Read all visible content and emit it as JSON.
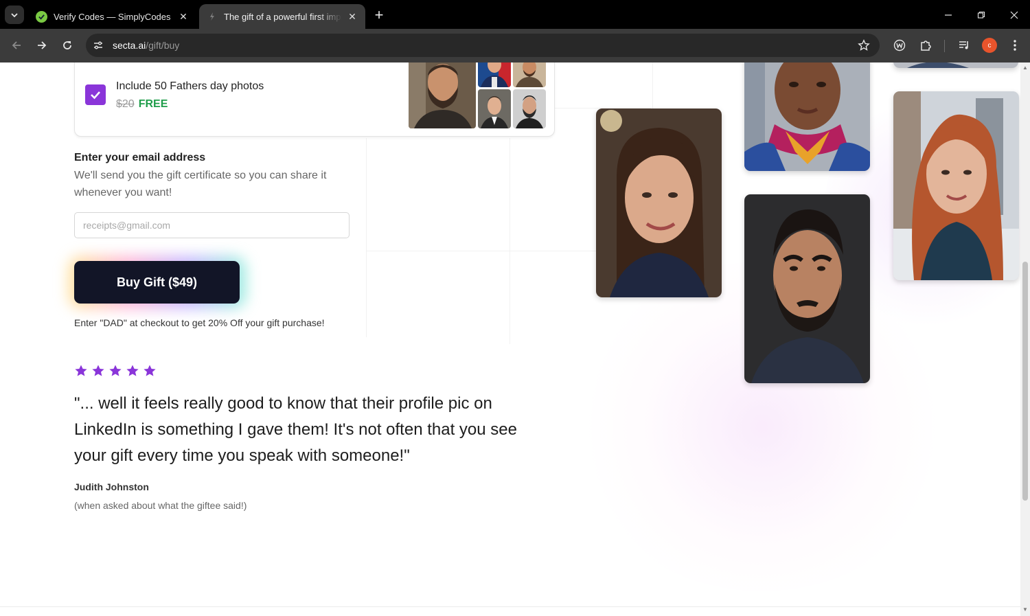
{
  "browser": {
    "tabs": [
      {
        "title": "Verify Codes — SimplyCodes",
        "active": false
      },
      {
        "title": "The gift of a powerful first impression",
        "active": true
      }
    ],
    "url_host": "secta.ai",
    "url_path": "/gift/buy",
    "profile_initial": "c"
  },
  "offer": {
    "title": "Include 50 Fathers day photos",
    "old_price": "$20",
    "new_price": "FREE",
    "checked": true
  },
  "email": {
    "label": "Enter your email address",
    "help": "We'll send you the gift certificate so you can share it whenever you want!",
    "placeholder": "receipts@gmail.com",
    "value": ""
  },
  "buy_button_label": "Buy Gift ($49)",
  "promo_text": "Enter \"DAD\" at checkout to get 20% Off your gift purchase!",
  "testimonial": {
    "rating": 5,
    "quote": "\"... well it feels really good to know that their profile pic on LinkedIn is something I gave them! It's not often that you see your gift every time you speak with someone!\"",
    "author": "Judith Johnston",
    "note": "(when asked about what the giftee said!)"
  },
  "colors": {
    "accent_purple": "#8a35d9",
    "free_green": "#1f9d4a",
    "button_dark": "#121527"
  },
  "icons": [
    "tab-search-icon",
    "simplycodes-favicon",
    "secta-favicon",
    "close-icon",
    "plus-icon",
    "minimize-icon",
    "restore-icon",
    "back-icon",
    "forward-icon",
    "reload-icon",
    "site-info-icon",
    "star-bookmark-icon",
    "extension-w-icon",
    "puzzle-icon",
    "media-icon",
    "menu-icon",
    "check-icon",
    "rating-star-icon"
  ]
}
